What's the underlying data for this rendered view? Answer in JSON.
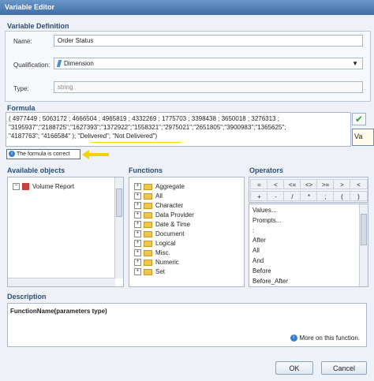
{
  "window": {
    "title": "Variable Editor"
  },
  "variable_definition": {
    "section_title": "Variable Definition",
    "name_label": "Name:",
    "name_value": "Order Status",
    "qualification_label": "Qualification:",
    "qualification_value": "Dimension",
    "type_label": "Type:",
    "type_value": "string"
  },
  "formula": {
    "section_title": "Formula",
    "lines": [
      "( 4977449 ; 5063172 ; 4666504 ; 4965819 ; 4332269 ; 1775703 ; 3398438 ; 3650018 ; 3276313 ;",
      "\"3195937\";\"2188725\";\"1627393\";\"1372922\";\"1558321\";\"2975021\";\"2651805\";\"3900983\";\"1365625\";",
      "\"4187763\"; \"4166584\" ); \"Delivered\"; \"Not Delivered\")"
    ],
    "status_text": "The formula is correct",
    "side_button_label": "Va"
  },
  "available_objects": {
    "section_title": "Available objects",
    "items": [
      {
        "label": "Volume Report"
      }
    ]
  },
  "functions": {
    "section_title": "Functions",
    "items": [
      {
        "label": "Aggregate"
      },
      {
        "label": "All"
      },
      {
        "label": "Character"
      },
      {
        "label": "Data Provider"
      },
      {
        "label": "Date & Time"
      },
      {
        "label": "Document"
      },
      {
        "label": "Logical"
      },
      {
        "label": "Misc."
      },
      {
        "label": "Numeric"
      },
      {
        "label": "Set"
      }
    ]
  },
  "operators": {
    "section_title": "Operators",
    "row1": [
      "=",
      "<",
      "<=",
      "<>",
      ">=",
      ">",
      "<"
    ],
    "row2": [
      "+",
      "-",
      "/",
      "*",
      ";",
      "(",
      ")"
    ],
    "list": [
      "Values...",
      "Prompts...",
      ":",
      "After",
      "All",
      "And",
      "Before",
      "Before_After"
    ]
  },
  "description": {
    "section_title": "Description",
    "text": "FunctionName(parameters type)",
    "more_link": "More on this function."
  },
  "footer": {
    "ok": "OK",
    "cancel": "Cancel"
  },
  "colors": {
    "accent": "#2a4e78",
    "annotation_arrow": "#f2d200",
    "check": "#3a9a2a"
  }
}
